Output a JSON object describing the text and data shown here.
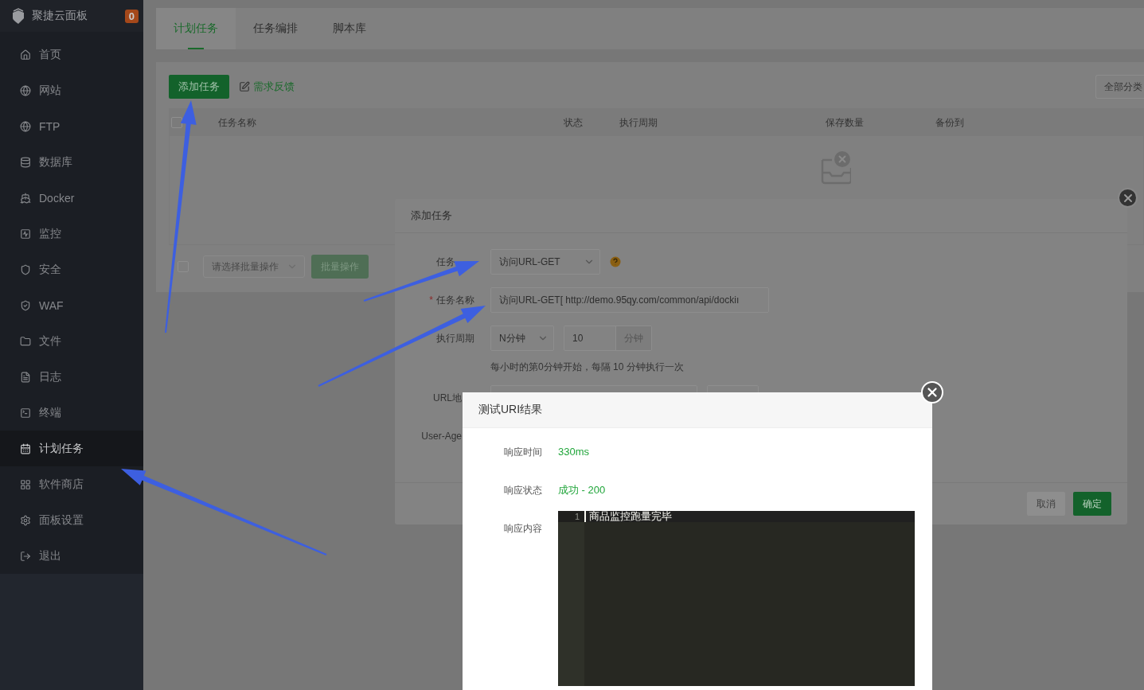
{
  "sidebar": {
    "logo": "聚捷云面板",
    "badge": "0",
    "items": [
      {
        "label": "首页",
        "selected": false
      },
      {
        "label": "网站",
        "selected": false
      },
      {
        "label": "FTP",
        "selected": false
      },
      {
        "label": "数据库",
        "selected": false
      },
      {
        "label": "Docker",
        "selected": false
      },
      {
        "label": "监控",
        "selected": false
      },
      {
        "label": "安全",
        "selected": false
      },
      {
        "label": "WAF",
        "selected": false
      },
      {
        "label": "文件",
        "selected": false
      },
      {
        "label": "日志",
        "selected": false
      },
      {
        "label": "终端",
        "selected": false
      },
      {
        "label": "计划任务",
        "selected": true
      },
      {
        "label": "软件商店",
        "selected": false
      },
      {
        "label": "面板设置",
        "selected": false
      },
      {
        "label": "退出",
        "selected": false
      }
    ]
  },
  "tabs": [
    {
      "label": "计划任务",
      "selected": true
    },
    {
      "label": "任务编排",
      "selected": false
    },
    {
      "label": "脚本库",
      "selected": false
    }
  ],
  "toolbar": {
    "add_button": "添加任务",
    "feedback_link": "需求反馈",
    "category_select": "全部分类"
  },
  "table": {
    "checkbox": {
      "checked": false
    },
    "columns": [
      "任务名称",
      "状态",
      "执行周期",
      "保存数量",
      "备份到"
    ]
  },
  "batch": {
    "checkbox": {
      "checked": false
    },
    "placeholder": "请选择批量操作",
    "button": {
      "label": "批量操作",
      "disabled": true
    }
  },
  "add_dialog": {
    "title": "添加任务",
    "fields": [
      {
        "kind": "select",
        "label": "任务",
        "value": "访问URL-GET"
      },
      {
        "kind": "input",
        "label": "任务名称",
        "value": "访问URL-GET[ http://demo.95qy.com/common/api/dockiı",
        "required_mark": "*"
      },
      {
        "kind": "period",
        "label": "执行周期",
        "select": "N分钟",
        "value": "10",
        "unit": "分钟",
        "hint": "每小时的第0分钟开始，每隔 10 分钟执行一次"
      },
      {
        "kind": "url",
        "label": "URL地"
      },
      {
        "kind": "text",
        "label": "User-Age"
      }
    ],
    "buttons": [
      {
        "label": "取消",
        "disabled": true
      },
      {
        "label": "确定",
        "disabled": false
      }
    ]
  },
  "result_dialog": {
    "title": "测试URI结果",
    "rows": [
      {
        "label": "响应时间",
        "value": "330ms"
      },
      {
        "label": "响应状态",
        "value": "成功 - 200"
      }
    ],
    "content_label": "响应内容",
    "editor": {
      "lines": [
        {
          "number": "1",
          "text": "商品监控跑量完毕"
        }
      ]
    }
  }
}
